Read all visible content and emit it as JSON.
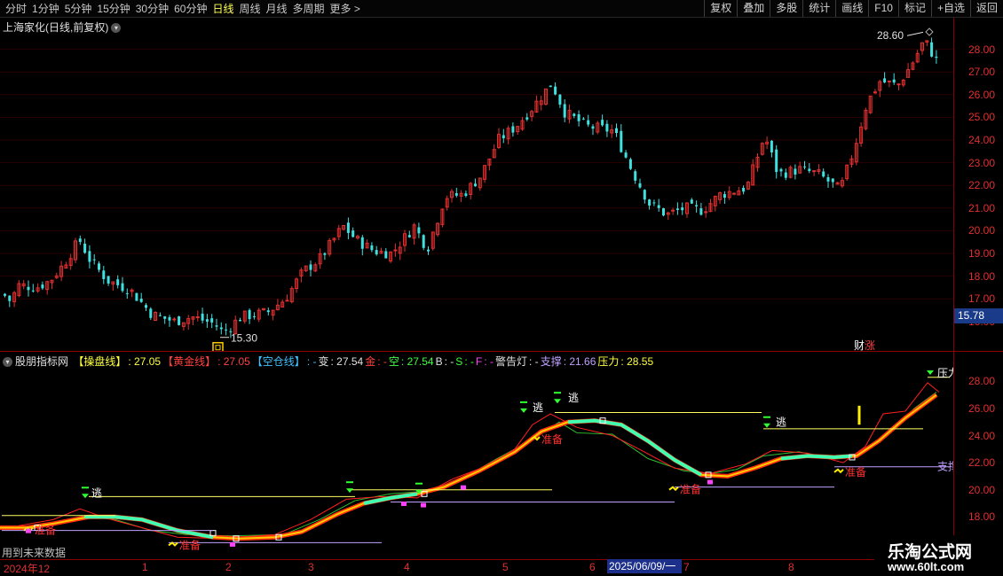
{
  "toolbar": {
    "periods": [
      "分时",
      "1分钟",
      "5分钟",
      "15分钟",
      "30分钟",
      "60分钟",
      "日线",
      "周线",
      "月线",
      "多周期",
      "更多 >"
    ],
    "active_period": "日线",
    "tools": [
      "复权",
      "叠加",
      "多股",
      "统计",
      "画线",
      "F10",
      "标记",
      "+自选",
      "返回"
    ]
  },
  "main_chart": {
    "title": "上海家化(日线,前复权)",
    "high_label": "28.60",
    "low_label": "15.30",
    "current_price": "15.78",
    "badge": "财",
    "badge2": "涨",
    "price_ticks": [
      "28.00",
      "27.00",
      "26.00",
      "25.00",
      "24.00",
      "23.00",
      "22.00",
      "21.00",
      "20.00",
      "19.00",
      "18.00",
      "17.00",
      "16.00"
    ],
    "colors": {
      "up": "#e03030",
      "down": "#40e0e0"
    }
  },
  "indicator": {
    "name": "股朋指标网",
    "items": [
      {
        "label": "【操盘线】",
        "value": ": 27.05",
        "color": "#ffff40"
      },
      {
        "label": "【黄金线】",
        "value": ": 27.05",
        "color": "#ff4040"
      },
      {
        "label": "【空仓线】",
        "value": ": -",
        "color": "#40c0ff"
      },
      {
        "label": "变",
        "value": ": 27.54",
        "color": "#e0e0e0"
      },
      {
        "label": "金",
        "value": ": -",
        "color": "#ff4040"
      },
      {
        "label": "空",
        "value": ": 27.54",
        "color": "#40ff40"
      },
      {
        "label": "B",
        "value": ": -",
        "color": "#e0e0e0"
      },
      {
        "label": "S",
        "value": ": -",
        "color": "#40ff40"
      },
      {
        "label": "F",
        "value": ": -",
        "color": "#ff40ff"
      },
      {
        "label": "警告灯",
        "value": ": -",
        "color": "#e0e0e0"
      },
      {
        "label": "支撑",
        "value": ": 21.66",
        "color": "#c0a0ff"
      },
      {
        "label": "压力",
        "value": ": 28.55",
        "color": "#ffff40"
      }
    ],
    "ticks": [
      "28.00",
      "26.00",
      "24.00",
      "22.00",
      "20.00",
      "18.00"
    ],
    "signals": {
      "escape": "逃",
      "prepare": "准备",
      "support": "支撑",
      "pressure": "压力"
    },
    "future_note": "用到未来数据"
  },
  "x_axis": {
    "labels": [
      "2024年12",
      "1",
      "2",
      "3",
      "4",
      "5",
      "6",
      "7",
      "8"
    ],
    "cursor_date": "2025/06/09/一"
  },
  "watermark": {
    "line1": "乐淘公式网",
    "line2": "www.60lt.com"
  }
}
